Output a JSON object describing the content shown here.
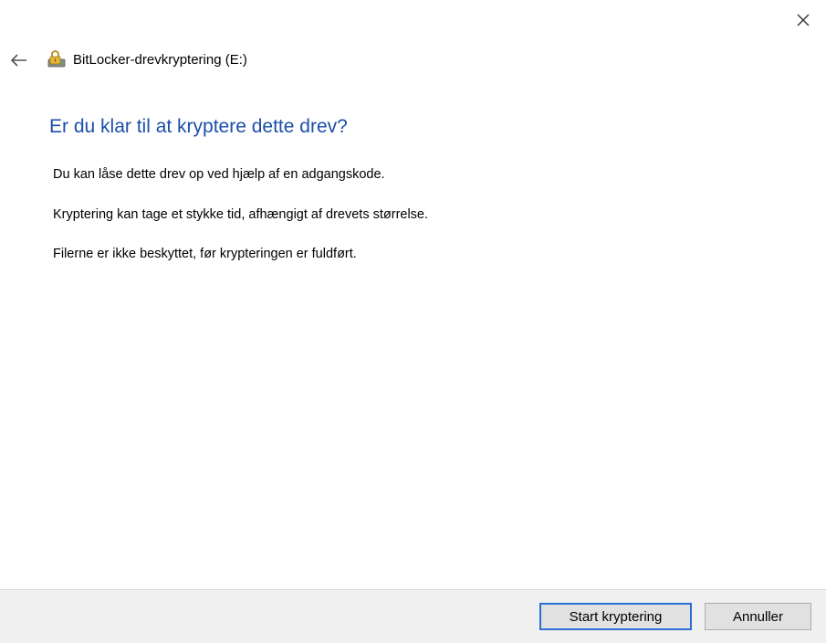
{
  "window": {
    "app_title": "BitLocker-drevkryptering (E:)",
    "icons": {
      "close": "close-icon",
      "back": "back-arrow-icon",
      "app": "bitlocker-drive-icon"
    }
  },
  "content": {
    "heading": "Er du klar til at kryptere dette drev?",
    "paragraphs": [
      "Du kan låse dette drev op ved hjælp af en adgangskode.",
      "Kryptering kan tage et stykke tid, afhængigt af drevets størrelse.",
      "Filerne er ikke beskyttet, før krypteringen er fuldført."
    ]
  },
  "footer": {
    "start_label": "Start kryptering",
    "cancel_label": "Annuller"
  },
  "colors": {
    "heading": "#1c4fa8",
    "footer_bg": "#f0f0f0",
    "primary_border": "#2b6fd1"
  }
}
